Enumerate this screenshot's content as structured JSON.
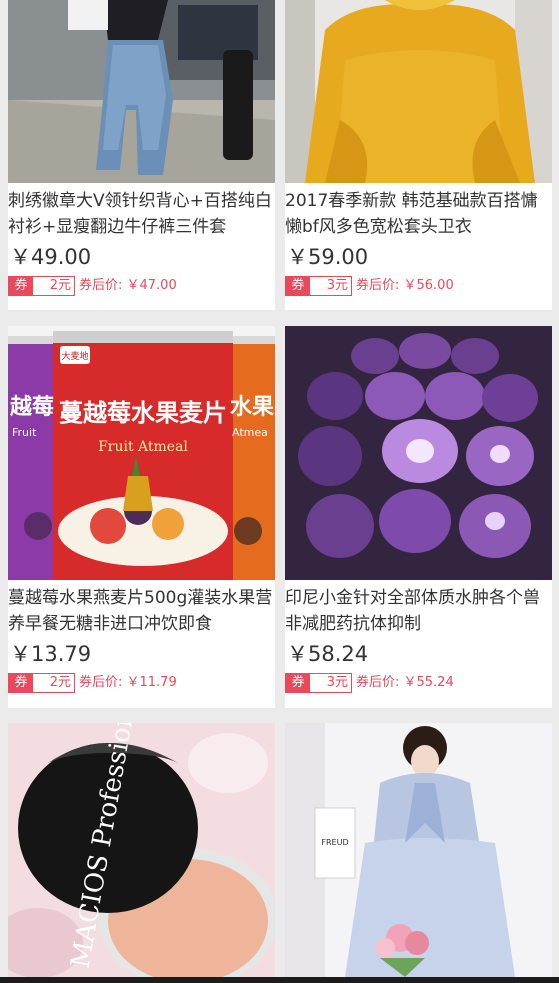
{
  "products": [
    {
      "title": "刺绣徽章大V领针织背心+百搭纯白衬衫+显瘦翻边牛仔裤三件套",
      "price": "￥49.00",
      "coupon_tag": "券",
      "coupon_amount": "2元",
      "after_price": "券后价: ￥47.00"
    },
    {
      "title": "2017春季新款 韩范基础款百搭慵懒bf风多色宽松套头卫衣",
      "price": "￥59.00",
      "coupon_tag": "券",
      "coupon_amount": "3元",
      "after_price": "券后价: ￥56.00"
    },
    {
      "title": "蔓越莓水果燕麦片500g灌装水果营养早餐无糖非进口冲饮即食",
      "price": "￥13.79",
      "coupon_tag": "券",
      "coupon_amount": "2元",
      "after_price": "券后价: ￥11.79"
    },
    {
      "title": "印尼小金针对全部体质水肿各个兽非减肥药抗体抑制",
      "price": "￥58.24",
      "coupon_tag": "券",
      "coupon_amount": "3元",
      "after_price": "券后价: ￥55.24"
    },
    {
      "image_text": "MACIOS Professional"
    },
    {
      "image_text": "FREUD"
    }
  ],
  "oatmeal_image": {
    "brand": "大麦地",
    "label_main": "蔓越莓水果麦片",
    "label_sub": "Fruit Atmeal",
    "label_left": "越莓",
    "label_left_sub": "Fruit",
    "label_right": "水果",
    "label_right_sub": "Atmea"
  },
  "colors": {
    "accent": "#e8495c",
    "background": "#ebebeb"
  }
}
